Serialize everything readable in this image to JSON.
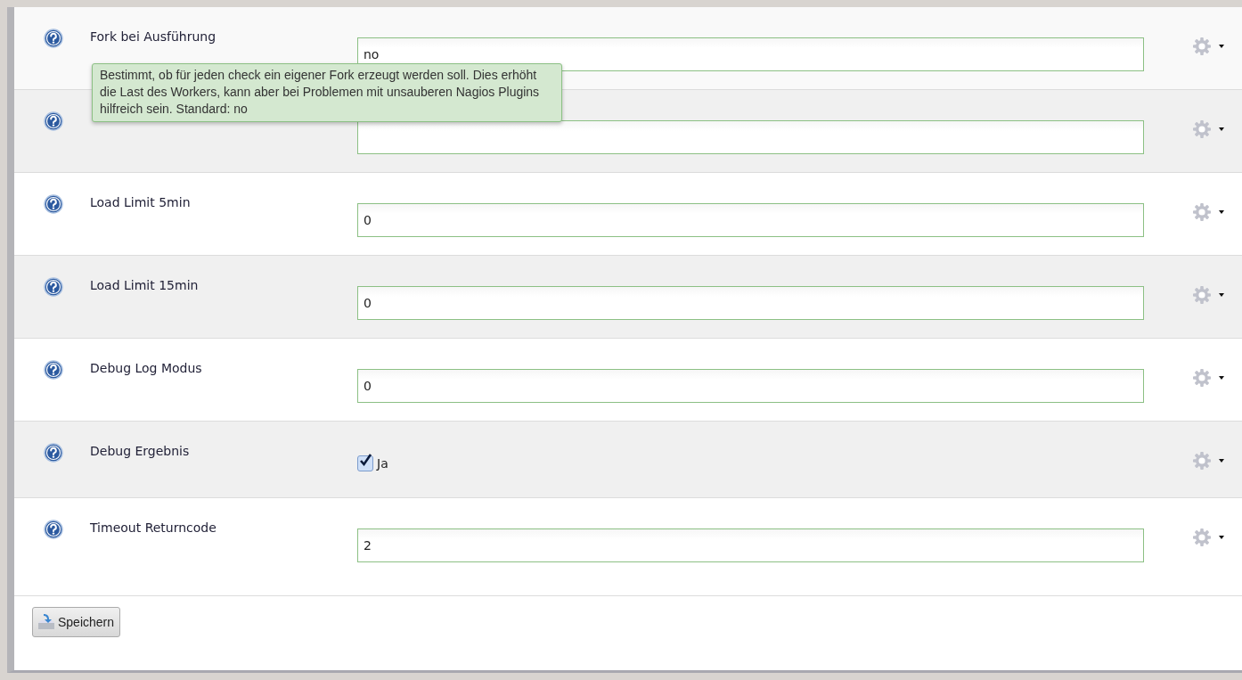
{
  "settings": [
    {
      "kind": "text",
      "label": "Fork bei Ausführung",
      "value": "no"
    },
    {
      "kind": "text"
    },
    {
      "kind": "text",
      "label": "Load Limit 5min",
      "value": "0"
    },
    {
      "kind": "text",
      "label": "Load Limit 15min",
      "value": "0"
    },
    {
      "kind": "text",
      "label": "Debug Log Modus",
      "value": "0"
    },
    {
      "kind": "checkbox",
      "label": "Debug Ergebnis",
      "option": "Ja",
      "checked": true
    },
    {
      "kind": "text",
      "label": "Timeout Returncode",
      "value": "2"
    }
  ],
  "tooltip": "Bestimmt, ob für jeden check ein eigener Fork erzeugt werden soll. Dies erhöht die Last des Workers, kann aber bei Problemen mit unsauberen Nagios Plugins hilfreich sein. Standard: no",
  "save_button": "Speichern"
}
